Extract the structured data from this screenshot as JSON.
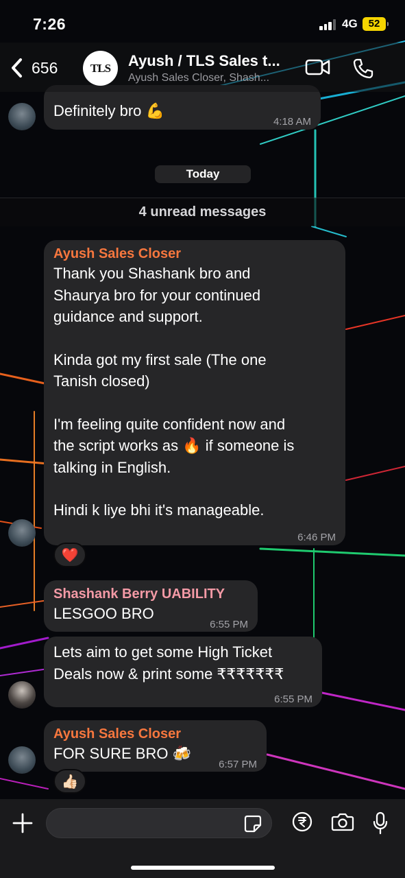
{
  "status_bar": {
    "time": "7:26",
    "network": "4G",
    "battery": "52"
  },
  "header": {
    "back_count": "656",
    "avatar_text": "TLS",
    "title": "Ayush / TLS Sales t...",
    "subtitle": "Ayush Sales Closer, Shash..."
  },
  "messages": {
    "prev": {
      "text": "Definitely bro 💪",
      "time": "4:18 AM"
    },
    "today_label": "Today",
    "unread_label": "4 unread messages",
    "m1": {
      "sender": "Ayush Sales Closer",
      "lines": [
        "Thank you Shashank bro and",
        "Shaurya bro for your continued",
        "guidance and support."
      ],
      "lines2": [
        "Kinda got my first sale (The one",
        "Tanish closed)"
      ],
      "lines3": [
        "I'm feeling quite confident now and",
        "the script works as 🔥 if someone is",
        "talking in English."
      ],
      "lines4": [
        "Hindi k liye bhi it's manageable."
      ],
      "time": "6:46 PM",
      "reaction": "❤️"
    },
    "m2": {
      "sender": "Shashank Berry UABILITY",
      "text": "LESGOO BRO",
      "time": "6:55 PM"
    },
    "m3": {
      "lines": [
        "Lets aim to get some High Ticket",
        "Deals now & print some ₹₹₹₹₹₹₹"
      ],
      "time": "6:55 PM"
    },
    "m4": {
      "sender": "Ayush Sales Closer",
      "text": "FOR SURE BRO 🍻",
      "time": "6:57 PM",
      "reaction": "👍🏻"
    }
  },
  "input": {
    "placeholder": ""
  },
  "colors": {
    "sender_orange": "#f7773e",
    "sender_pink": "#f49aa6",
    "bubble": "#262628"
  }
}
